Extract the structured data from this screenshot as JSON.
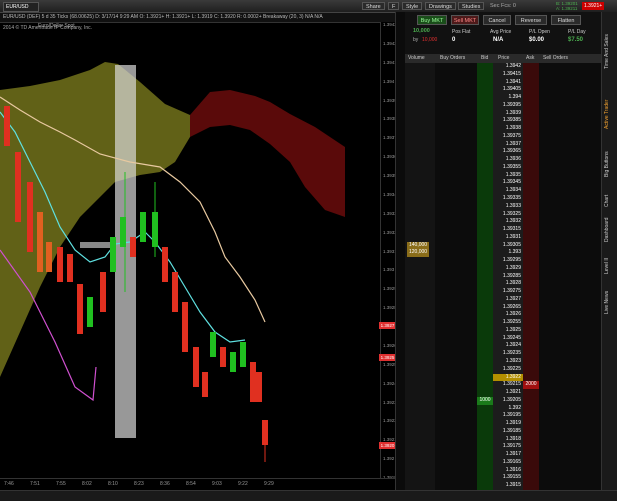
{
  "toolbar": {
    "symbol": "EUR/USD",
    "share": "Share",
    "style": "Style",
    "drawings": "Drawings",
    "studies": "Studies",
    "sec_label": "Sec Fcs: 0",
    "f_badge": "F"
  },
  "quote_line": "EUR/USD (DEF) 5 d 35 Ticks (68.00625)   D: 3/17/14 9:29 AM  O: 1.3921+  H: 1.3921+  L: 1.3919  C: 1.3920  R: 0.0002+  Breakaway (20, 3)  N/A  N/A",
  "chart_caption": "Euro/Dollar Spot",
  "copyright": "2014 © TD Ameritrade IP Company, Inc.",
  "y_ticks": [
    "1.3943",
    "1.3942",
    "1.3941",
    "1.394",
    "1.3939",
    "1.3938",
    "1.3937",
    "1.3936",
    "1.3935",
    "1.3934",
    "1.3933",
    "1.3932",
    "1.3931",
    "1.393",
    "1.3929",
    "1.3928",
    "1.3927",
    "1.3926",
    "1.3925",
    "1.3924",
    "1.3923",
    "1.3922",
    "1.3921",
    "1.392",
    "1.3919"
  ],
  "price_tags": [
    {
      "value": "1.3927",
      "color": "#e03030"
    },
    {
      "value": "1.3925",
      "color": "#e03030"
    },
    {
      "value": "1.3920",
      "color": "#e03030"
    }
  ],
  "x_ticks": [
    "7:46",
    "7:51",
    "7:55",
    "8:02",
    "8:10",
    "8:23",
    "8:36",
    "8:54",
    "9:03",
    "9:22",
    "9:29"
  ],
  "order": {
    "buy_label": "Buy MKT",
    "sell_label": "Sell MKT",
    "cancel_label": "Cancel",
    "reverse_label": "Reverse",
    "flatten_label": "Flatten",
    "qty": "10,000",
    "qty_by": "by",
    "qty_sub": "10,000",
    "pos_label": "Pos Flat",
    "pos_value": "0",
    "avg_label": "Avg Price",
    "avg_value": "N/A",
    "plopen_label": "P/L Open",
    "plopen_value": "$0.00",
    "plday_label": "P/L Day",
    "plday_value": "$7.50"
  },
  "ladder_headers": [
    "Volume",
    "Buy Orders",
    "Bid",
    "Price",
    "Ask",
    "Sell Orders"
  ],
  "ladder_prices": [
    "1.3942",
    "1.39415",
    "1.3941",
    "1.39405",
    "1.394",
    "1.39395",
    "1.3939",
    "1.39385",
    "1.3938",
    "1.39375",
    "1.3937",
    "1.39365",
    "1.3936",
    "1.39355",
    "1.3935",
    "1.39345",
    "1.3934",
    "1.39335",
    "1.3933",
    "1.39325",
    "1.3932",
    "1.39315",
    "1.3931",
    "1.39305",
    "1.393",
    "1.39295",
    "1.3929",
    "1.39285",
    "1.3928",
    "1.39275",
    "1.3927",
    "1.39265",
    "1.3926",
    "1.39255",
    "1.3925",
    "1.39245",
    "1.3924",
    "1.39235",
    "1.3923",
    "1.39225",
    "1.3922",
    "1.39215",
    "1.3921",
    "1.39205",
    "1.392",
    "1.39195",
    "1.3919",
    "1.39185",
    "1.3918",
    "1.39175",
    "1.3917",
    "1.39165",
    "1.3916",
    "1.39155",
    "1.3915"
  ],
  "ladder_volume": [
    {
      "row": 23,
      "value": "140,000"
    },
    {
      "row": 24,
      "value": "120,000"
    }
  ],
  "ladder_bid": {
    "row": 43,
    "value": "1000"
  },
  "ladder_ask": {
    "row": 41,
    "value": "2000"
  },
  "ladder_highlight_row": 40,
  "side_tabs": [
    "Time And Sales",
    "Active Trader",
    "Big Buttons",
    "Chart",
    "Dashboard",
    "Level II",
    "Live News"
  ],
  "status": {
    "line1": "B: 1.39201",
    "line2": "A: 1.39211",
    "badge": "1.3921+"
  }
}
